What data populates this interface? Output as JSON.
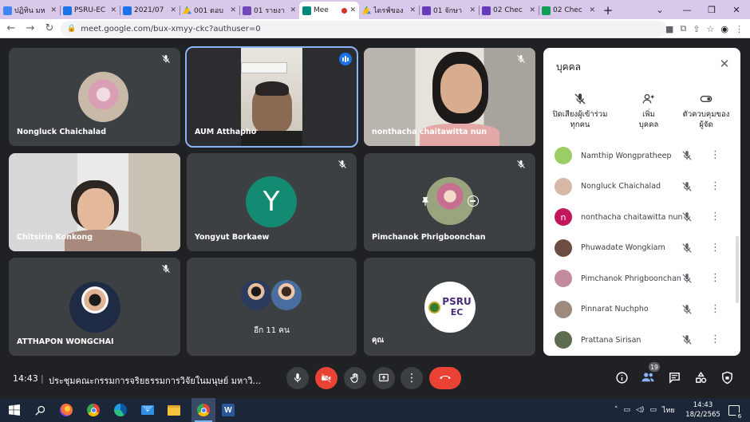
{
  "browser": {
    "tabs": [
      {
        "title": "ปฏิทิน มห",
        "favicon_color": "#4285f4"
      },
      {
        "title": "PSRU-EC",
        "favicon_color": "#1a73e8"
      },
      {
        "title": "2021/07",
        "favicon_color": "#1a73e8"
      },
      {
        "title": "001 ตอบ",
        "favicon_color": "#7248b9"
      },
      {
        "title": "01 รายงา",
        "favicon_color": "#7248b9"
      },
      {
        "title": "Mee",
        "favicon_color": "#00897b",
        "active": true
      },
      {
        "title": "ไดรฟ์ของ",
        "favicon_color": "#7248b9"
      },
      {
        "title": "01 จักษา",
        "favicon_color": "#673ab7"
      },
      {
        "title": "02 Chec",
        "favicon_color": "#673ab7"
      },
      {
        "title": "02 Chec",
        "favicon_color": "#0f9d58"
      }
    ],
    "new_tab_label": "+",
    "url": "meet.google.com/bux-xmyy-ckc?authuser=0"
  },
  "meet": {
    "tiles": [
      {
        "name": "Nongluck Chaichalad",
        "type": "avatar",
        "muted": true
      },
      {
        "name": "AUM Atthapho",
        "type": "video",
        "speaking": true
      },
      {
        "name": "nonthacha chaitawitta nun",
        "type": "video",
        "muted": true
      },
      {
        "name": "Chitsirin Konkong",
        "type": "video"
      },
      {
        "name": "Yongyut Borkaew",
        "type": "letter",
        "letter": "Y",
        "muted": true
      },
      {
        "name": "Pimchanok Phrigboonchan",
        "type": "avatar",
        "muted": true
      },
      {
        "name": "ATTHAPON WONGCHAI",
        "type": "avatar",
        "muted": true
      },
      {
        "name": "อีก 11 คน",
        "type": "group"
      },
      {
        "name": "คุณ",
        "type": "self",
        "logo_text_1": "PSRU",
        "logo_text_2": "EC"
      }
    ],
    "panel": {
      "title": "บุคคล",
      "actions": [
        {
          "line1": "ปิดเสียงผู้เข้าร่วม",
          "line2": "ทุกคน",
          "icon": "mic-off-icon"
        },
        {
          "line1": "เพิ่ม",
          "line2": "บุคคล",
          "icon": "add-person-icon"
        },
        {
          "line1": "ตัวควบคุมของ",
          "line2": "ผู้จัด",
          "icon": "toggle-icon"
        }
      ],
      "participants": [
        {
          "name": "Namthip Wongpratheep",
          "avatar_color": "#9ccc65"
        },
        {
          "name": "Nongluck Chaichalad",
          "avatar_color": "#d7b8a6"
        },
        {
          "name": "nonthacha chaitawitta nun",
          "avatar_color": "#c2185b",
          "letter": "n"
        },
        {
          "name": "Phuwadate Wongkiam",
          "avatar_color": "#6d4c41"
        },
        {
          "name": "Pimchanok Phrigboonchan",
          "avatar_color": "#c48b9f"
        },
        {
          "name": "Pinnarat Nuchpho",
          "avatar_color": "#9e8a7c"
        },
        {
          "name": "Prattana Sirisan",
          "avatar_color": "#5d6b4f"
        }
      ]
    },
    "bottom": {
      "time": "14:43",
      "separator": "|",
      "meeting_title": "ประชุมคณะกรรมการจริยธรรมการวิจัยในมนุษย์ มหาวิ...",
      "people_count": "19"
    }
  },
  "taskbar": {
    "language": "ไทย",
    "clock_time": "14:43",
    "clock_date": "18/2/2565",
    "notifications": "6"
  }
}
